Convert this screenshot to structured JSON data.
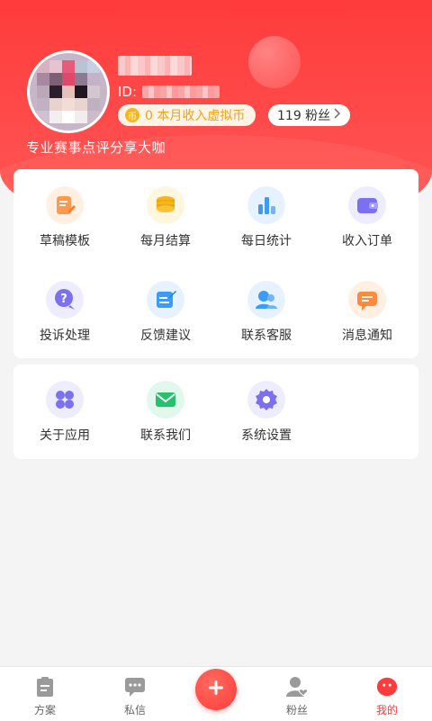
{
  "profile": {
    "id_label": "ID:",
    "coin_glyph": "币",
    "income_text": "0 本月收入虚拟币",
    "fans_text": "119 粉丝",
    "slogan": "专业赛事点评分享大咖"
  },
  "menu_primary": [
    {
      "label": "草稿模板",
      "icon": "draft-icon",
      "color": "#ff9a4c"
    },
    {
      "label": "每月结算",
      "icon": "coins-icon",
      "color": "#f5b51b"
    },
    {
      "label": "每日统计",
      "icon": "bar-chart-icon",
      "color": "#3c9cf5"
    },
    {
      "label": "收入订单",
      "icon": "wallet-icon",
      "color": "#7b70f0"
    },
    {
      "label": "投诉处理",
      "icon": "question-chat-icon",
      "color": "#7b70f0"
    },
    {
      "label": "反馈建议",
      "icon": "feedback-icon",
      "color": "#3c9cf5"
    },
    {
      "label": "联系客服",
      "icon": "customer-service-icon",
      "color": "#3c9cf5"
    },
    {
      "label": "消息通知",
      "icon": "message-icon",
      "color": "#ff8a3d"
    }
  ],
  "menu_secondary": [
    {
      "label": "关于应用",
      "icon": "apps-icon",
      "color": "#7b70f0"
    },
    {
      "label": "联系我们",
      "icon": "mail-icon",
      "color": "#25c26e"
    },
    {
      "label": "系统设置",
      "icon": "gear-icon",
      "color": "#7b70f0"
    }
  ],
  "tabbar": [
    {
      "label": "方案",
      "icon": "clipboard-icon",
      "active": false
    },
    {
      "label": "私信",
      "icon": "chat-icon",
      "active": false
    },
    {
      "label": "粉丝",
      "icon": "fans-icon",
      "active": false
    },
    {
      "label": "我的",
      "icon": "profile-face-icon",
      "active": true
    }
  ],
  "colors": {
    "primary": "#ff3b3b",
    "accent_gold": "#f3a316"
  }
}
